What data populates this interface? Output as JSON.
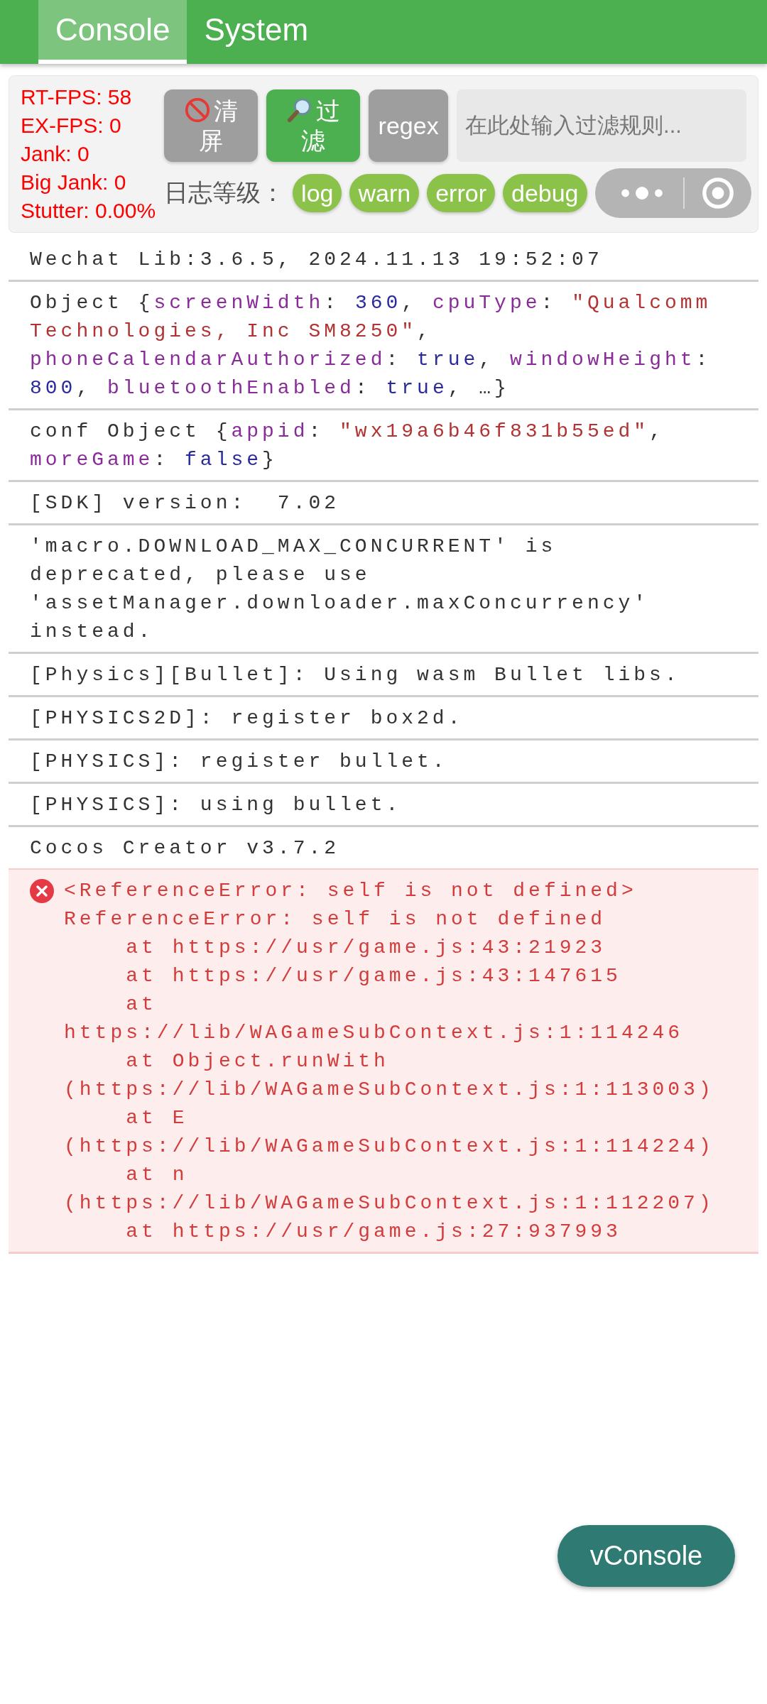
{
  "tabs": [
    {
      "label": "Console",
      "selected": true
    },
    {
      "label": "System",
      "selected": false
    }
  ],
  "toolbar": {
    "clear_button": "清屏",
    "filter_button": "过滤",
    "regex_button": "regex",
    "filter_input": {
      "placeholder": "在此处输入过滤规则..."
    },
    "level_label": "日志等级：",
    "levels": [
      "log",
      "warn",
      "error",
      "debug"
    ]
  },
  "perf_overlay": [
    "RT-FPS: 58",
    "EX-FPS: 0",
    "Jank: 0",
    "Big Jank: 0",
    "Stutter: 0.00%"
  ],
  "logs": [
    {
      "kind": "log",
      "parts": [
        {
          "kind": "plain",
          "text": "Wechat Lib:3.6.5, 2024.11.13 19:52:07"
        }
      ]
    },
    {
      "kind": "log",
      "parts": [
        {
          "kind": "plain",
          "text": "Object {"
        },
        {
          "kind": "key",
          "text": "screenWidth"
        },
        {
          "kind": "plain",
          "text": ": "
        },
        {
          "kind": "number",
          "text": "360"
        },
        {
          "kind": "plain",
          "text": ", "
        },
        {
          "kind": "key",
          "text": "cpuType"
        },
        {
          "kind": "plain",
          "text": ": "
        },
        {
          "kind": "string",
          "text": "\"Qualcomm Technologies, Inc SM8250\""
        },
        {
          "kind": "plain",
          "text": ", "
        },
        {
          "kind": "key",
          "text": "phoneCalendarAuthorized"
        },
        {
          "kind": "plain",
          "text": ": "
        },
        {
          "kind": "number",
          "text": "true"
        },
        {
          "kind": "plain",
          "text": ", "
        },
        {
          "kind": "key",
          "text": "windowHeight"
        },
        {
          "kind": "plain",
          "text": ": "
        },
        {
          "kind": "number",
          "text": "800"
        },
        {
          "kind": "plain",
          "text": ", "
        },
        {
          "kind": "key",
          "text": "bluetoothEnabled"
        },
        {
          "kind": "plain",
          "text": ": "
        },
        {
          "kind": "number",
          "text": "true"
        },
        {
          "kind": "plain",
          "text": ", …}"
        }
      ]
    },
    {
      "kind": "log",
      "parts": [
        {
          "kind": "plain",
          "text": "conf Object {"
        },
        {
          "kind": "key",
          "text": "appid"
        },
        {
          "kind": "plain",
          "text": ": "
        },
        {
          "kind": "string",
          "text": "\"wx19a6b46f831b55ed\""
        },
        {
          "kind": "plain",
          "text": ", "
        },
        {
          "kind": "key",
          "text": "moreGame"
        },
        {
          "kind": "plain",
          "text": ": "
        },
        {
          "kind": "number",
          "text": "false"
        },
        {
          "kind": "plain",
          "text": "}"
        }
      ]
    },
    {
      "kind": "log",
      "parts": [
        {
          "kind": "plain",
          "text": "[SDK] version:  7.02"
        }
      ]
    },
    {
      "kind": "log",
      "parts": [
        {
          "kind": "plain",
          "text": "'macro.DOWNLOAD_MAX_CONCURRENT' is deprecated, please use 'assetManager.downloader.maxConcurrency' instead."
        }
      ]
    },
    {
      "kind": "log",
      "parts": [
        {
          "kind": "plain",
          "text": "[Physics][Bullet]: Using wasm Bullet libs."
        }
      ]
    },
    {
      "kind": "log",
      "parts": [
        {
          "kind": "plain",
          "text": "[PHYSICS2D]: register box2d."
        }
      ]
    },
    {
      "kind": "log",
      "parts": [
        {
          "kind": "plain",
          "text": "[PHYSICS]: register bullet."
        }
      ]
    },
    {
      "kind": "log",
      "parts": [
        {
          "kind": "plain",
          "text": "[PHYSICS]: using bullet."
        }
      ]
    },
    {
      "kind": "log",
      "parts": [
        {
          "kind": "plain",
          "text": "Cocos Creator v3.7.2"
        }
      ]
    },
    {
      "kind": "error",
      "parts": [
        {
          "kind": "plain",
          "text": "<ReferenceError: self is not defined>\nReferenceError: self is not defined\n    at https://usr/game.js:43:21923\n    at https://usr/game.js:43:147615\n    at https://lib/WAGameSubContext.js:1:114246\n    at Object.runWith (https://lib/WAGameSubContext.js:1:113003)\n    at E (https://lib/WAGameSubContext.js:1:114224)\n    at n (https://lib/WAGameSubContext.js:1:112207)\n    at https://usr/game.js:27:937993"
        }
      ]
    }
  ],
  "vconsole_button": "vConsole"
}
